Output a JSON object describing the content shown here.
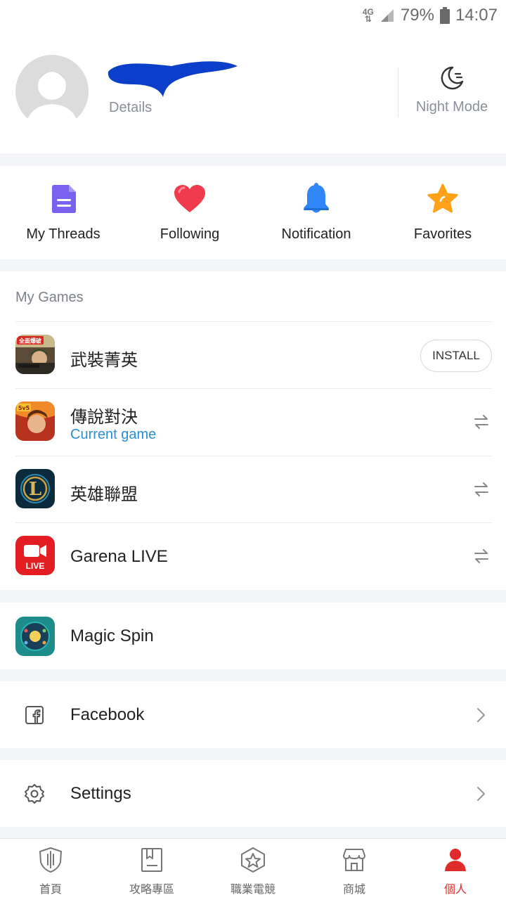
{
  "status_bar": {
    "network": "4G",
    "battery": "79%",
    "time": "14:07"
  },
  "profile": {
    "details_label": "Details",
    "night_mode_label": "Night Mode"
  },
  "quick_actions": [
    {
      "label": "My Threads",
      "icon": "document-icon"
    },
    {
      "label": "Following",
      "icon": "heart-icon"
    },
    {
      "label": "Notification",
      "icon": "bell-icon"
    },
    {
      "label": "Favorites",
      "icon": "star-icon"
    }
  ],
  "games": {
    "title": "My Games",
    "items": [
      {
        "name": "武裝菁英",
        "action": "INSTALL",
        "icon_badge": "全面爆破"
      },
      {
        "name": "傳說對決",
        "subtitle": "Current game",
        "icon_badge": "5v5"
      },
      {
        "name": "英雄聯盟",
        "icon_badge": "L"
      },
      {
        "name": "Garena LIVE",
        "icon_badge": "LIVE"
      }
    ]
  },
  "magic_spin": {
    "label": "Magic Spin"
  },
  "facebook": {
    "label": "Facebook"
  },
  "settings": {
    "label": "Settings"
  },
  "bottom_nav": [
    {
      "label": "首頁",
      "active": false
    },
    {
      "label": "攻略專區",
      "active": false
    },
    {
      "label": "職業電競",
      "active": false
    },
    {
      "label": "商城",
      "active": false
    },
    {
      "label": "個人",
      "active": true
    }
  ],
  "colors": {
    "accent_red": "#e02b2b",
    "link_blue": "#2b8fd6",
    "threads_purple": "#7b61f0",
    "heart_red": "#ef3b4d",
    "bell_blue": "#2f86f6",
    "star_orange": "#ffa21a"
  }
}
